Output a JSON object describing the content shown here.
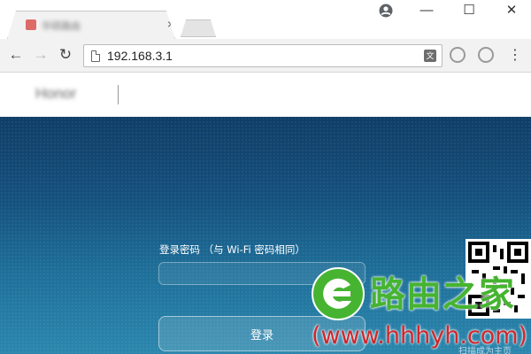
{
  "browser": {
    "tab_title": "华硕路由",
    "tab_close": "×",
    "window_controls": {
      "minimize": "—",
      "maximize": "☐",
      "close": "✕"
    },
    "nav": {
      "back": "←",
      "forward": "→",
      "reload": "↻",
      "menu": "⋮"
    },
    "url": "192.168.3.1",
    "translate_glyph": "文"
  },
  "page": {
    "logo_text": "Honor",
    "login_label": "登录密码 （与 Wi-Fi 密码相同）",
    "password_value": "",
    "login_button": "登录"
  },
  "watermark": {
    "name": "路由之家",
    "url": "(www.hhhyh.com)",
    "qr_caption": "扫描成为主页",
    "colors": {
      "green": "#46b431",
      "red": "#d0262b"
    }
  },
  "colors": {
    "bg_top": "#0f3e67",
    "bg_bottom": "#2b87ad"
  }
}
